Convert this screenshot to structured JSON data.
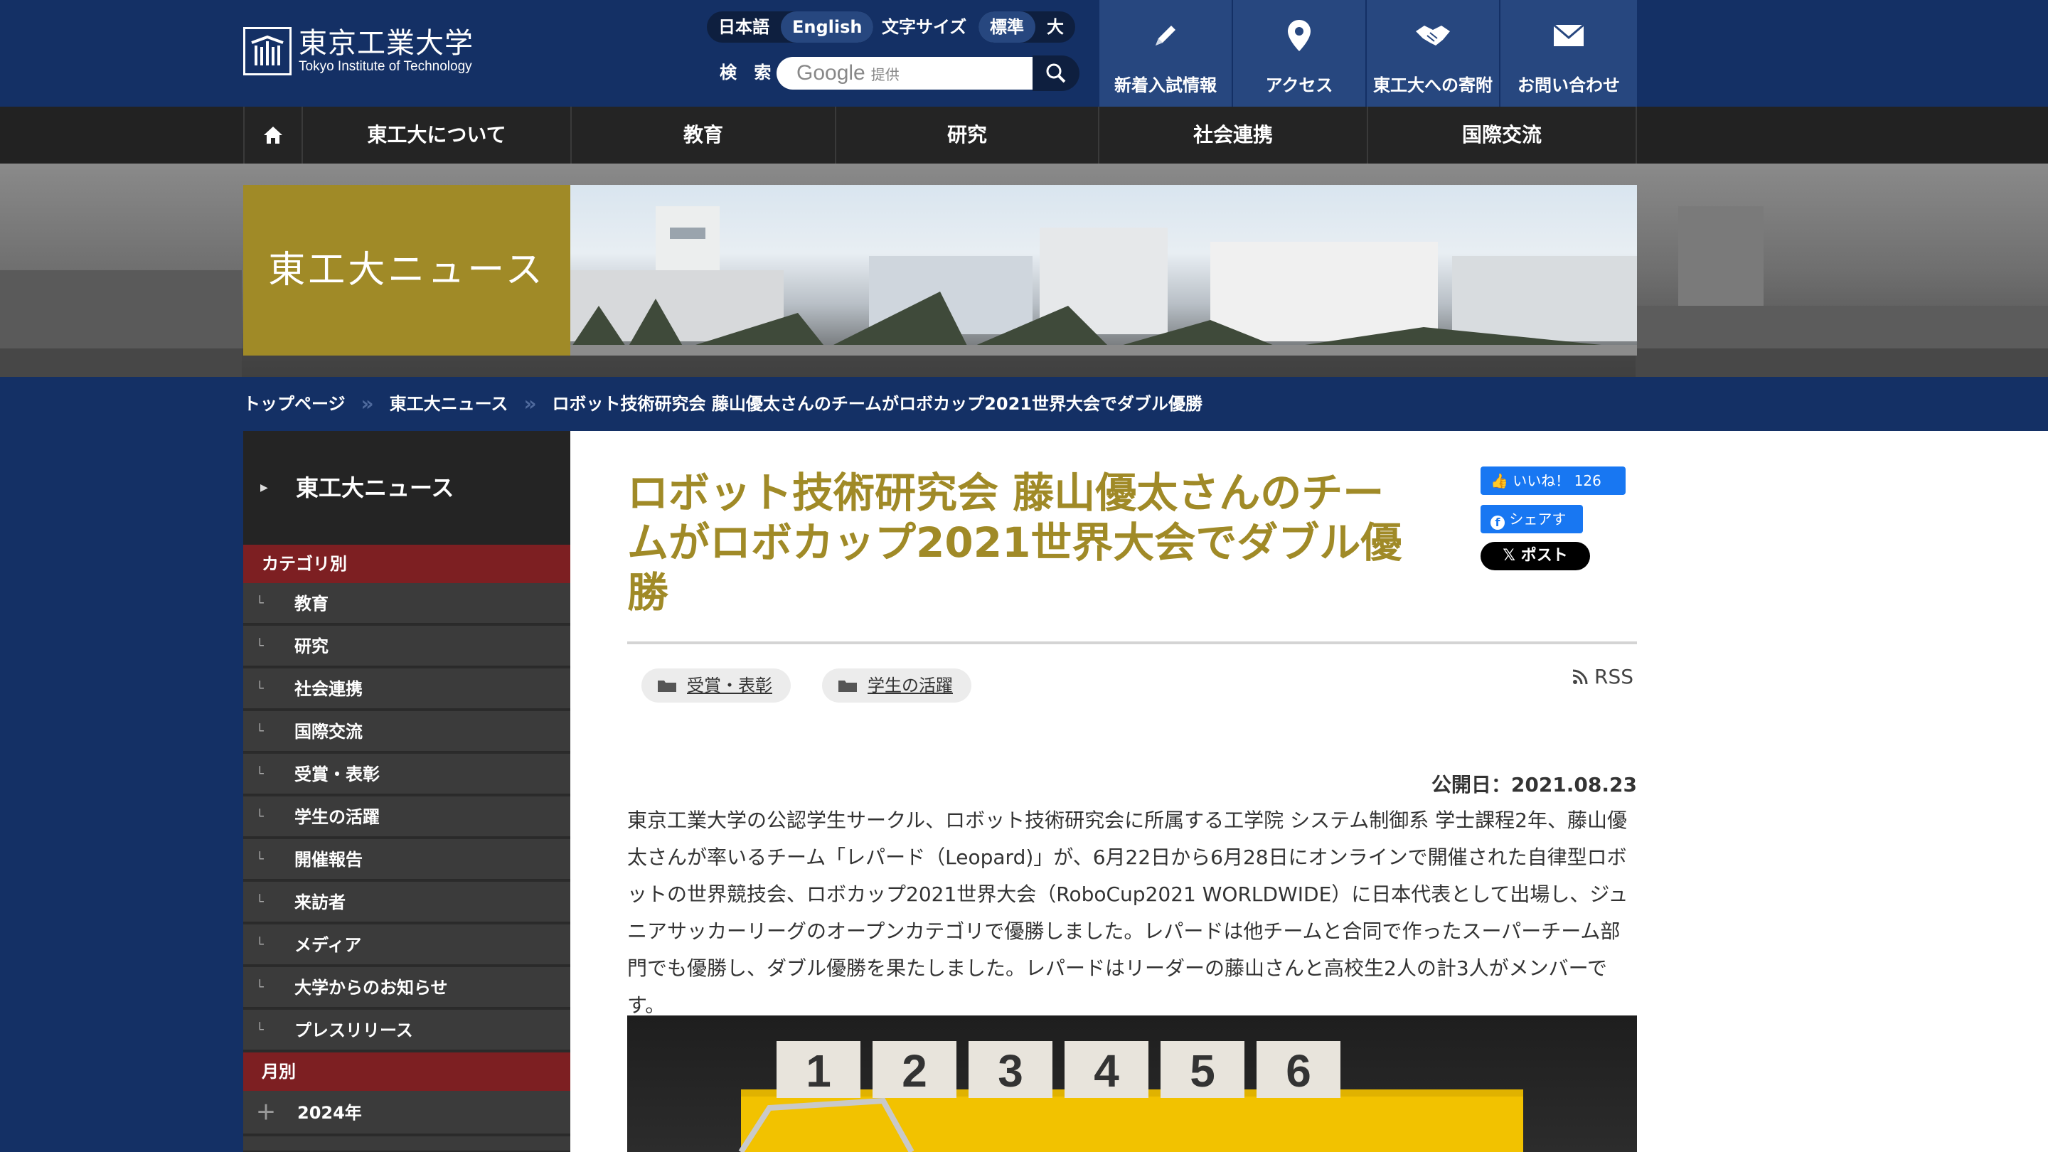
{
  "header": {
    "logo_jp": "東京工業大学",
    "logo_en": "Tokyo Institute of Technology",
    "lang_ja": "日本語",
    "lang_en": "English",
    "font_size_label": "文字サイズ",
    "size_standard": "標準",
    "size_large": "大",
    "search_label": "検 索",
    "search_brand": "Google",
    "search_brand_suffix": "提供",
    "quick_links": [
      {
        "label": "新着入試情報",
        "icon": "pencil-icon"
      },
      {
        "label": "アクセス",
        "icon": "map-pin-icon"
      },
      {
        "label": "東工大への寄附",
        "icon": "handshake-icon"
      },
      {
        "label": "お問い合わせ",
        "icon": "mail-icon"
      }
    ]
  },
  "nav": {
    "home_icon": "home-icon",
    "items": [
      "東工大について",
      "教育",
      "研究",
      "社会連携",
      "国際交流"
    ]
  },
  "hero": {
    "title": "東工大ニュース"
  },
  "breadcrumb": [
    "トップページ",
    "東工大ニュース",
    "ロボット技術研究会 藤山優太さんのチームがロボカップ2021世界大会でダブル優勝"
  ],
  "sidebar": {
    "title": "東工大ニュース",
    "category_header": "カテゴリ別",
    "categories": [
      "教育",
      "研究",
      "社会連携",
      "国際交流",
      "受賞・表彰",
      "学生の活躍",
      "開催報告",
      "来訪者",
      "メディア",
      "大学からのお知らせ",
      "プレスリリース"
    ],
    "monthly_header": "月別",
    "years": [
      "2024年"
    ]
  },
  "article": {
    "title": "ロボット技術研究会 藤山優太さんのチームがロボカップ2021世界大会でダブル優勝",
    "like_label": "いいね！",
    "like_count": "126",
    "share_label": "シェアす",
    "post_label": "ポスト",
    "tags": [
      "受賞・表彰",
      "学生の活躍"
    ],
    "rss": "RSS",
    "published": "公開日：2021.08.23",
    "body": "東京工業大学の公認学生サークル、ロボット技術研究会に所属する工学院 システム制御系 学士課程2年、藤山優太さんが率いるチーム「レパード（Leopard)」が、6月22日から6月28日にオンラインで開催された自律型ロボットの世界競技会、ロボカップ2021世界大会（RoboCup2021 WORLDWIDE）に日本代表として出場し、ジュニアサッカーリーグのオープンカテゴリで優勝しました。レパードは他チームと合同で作ったスーパーチーム部門でも優勝し、ダブル優勝を果たしました。レパードはリーダーの藤山さんと高校生2人の計3人がメンバーです。",
    "photo_digits": [
      "1",
      "2",
      "3",
      "4",
      "5",
      "6"
    ]
  },
  "colors": {
    "navy": "#143065",
    "gold": "#a08a27",
    "crimson": "#7d1f22",
    "quick_link_blue": "#27477f"
  }
}
